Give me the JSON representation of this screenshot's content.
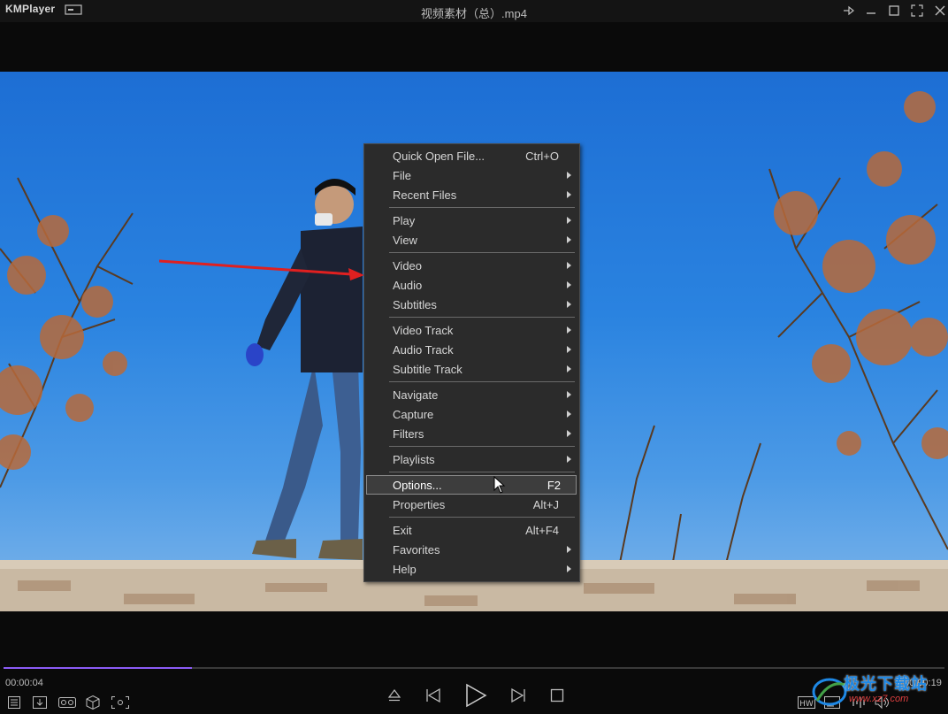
{
  "app": {
    "name": "KMPlayer",
    "window_title": "视频素材（总）.mp4"
  },
  "menu": {
    "items": [
      {
        "label": "Quick Open File...",
        "shortcut": "Ctrl+O",
        "submenu": false
      },
      {
        "label": "File",
        "shortcut": "",
        "submenu": true
      },
      {
        "label": "Recent Files",
        "shortcut": "",
        "submenu": true
      },
      {
        "label": "Play",
        "shortcut": "",
        "submenu": true
      },
      {
        "label": "View",
        "shortcut": "",
        "submenu": true
      },
      {
        "label": "Video",
        "shortcut": "",
        "submenu": true
      },
      {
        "label": "Audio",
        "shortcut": "",
        "submenu": true
      },
      {
        "label": "Subtitles",
        "shortcut": "",
        "submenu": true
      },
      {
        "label": "Video Track",
        "shortcut": "",
        "submenu": true
      },
      {
        "label": "Audio Track",
        "shortcut": "",
        "submenu": true
      },
      {
        "label": "Subtitle Track",
        "shortcut": "",
        "submenu": true
      },
      {
        "label": "Navigate",
        "shortcut": "",
        "submenu": true
      },
      {
        "label": "Capture",
        "shortcut": "",
        "submenu": true
      },
      {
        "label": "Filters",
        "shortcut": "",
        "submenu": true
      },
      {
        "label": "Playlists",
        "shortcut": "",
        "submenu": true
      },
      {
        "label": "Options...",
        "shortcut": "F2",
        "submenu": false,
        "highlighted": true
      },
      {
        "label": "Properties",
        "shortcut": "Alt+J",
        "submenu": false
      },
      {
        "label": "Exit",
        "shortcut": "Alt+F4",
        "submenu": false
      },
      {
        "label": "Favorites",
        "shortcut": "",
        "submenu": true
      },
      {
        "label": "Help",
        "shortcut": "",
        "submenu": true
      }
    ]
  },
  "playback": {
    "current_time": "00:00:04",
    "total_time": "00:00:19",
    "progress_fraction": 0.2
  },
  "icons": {
    "left_controls": [
      "playlist-icon",
      "download-icon",
      "vr-icon",
      "3d-cube-icon",
      "capture-frame-icon"
    ],
    "center_controls": [
      "eject-icon",
      "previous-icon",
      "play-icon",
      "next-icon",
      "stop-icon"
    ],
    "right_controls": [
      "hw-decode-icon",
      "subtitle-icon",
      "equalizer-icon",
      "volume-icon"
    ]
  },
  "watermark": {
    "text": "极光下载站",
    "url": "www.xz7.com"
  },
  "colors": {
    "accent": "#8b5cf6",
    "annotation_arrow": "#e02020"
  }
}
